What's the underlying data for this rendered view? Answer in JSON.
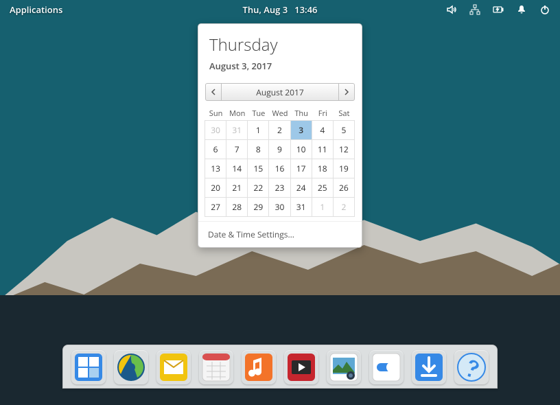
{
  "topbar": {
    "applications_label": "Applications",
    "date_text": "Thu, Aug  3",
    "time_text": "13:46"
  },
  "calendar": {
    "day_name": "Thursday",
    "full_date": "August  3, 2017",
    "month_label": "August 2017",
    "weekday_headers": [
      "Sun",
      "Mon",
      "Tue",
      "Wed",
      "Thu",
      "Fri",
      "Sat"
    ],
    "grid": [
      [
        {
          "n": "30",
          "dim": true
        },
        {
          "n": "31",
          "dim": true
        },
        {
          "n": "1"
        },
        {
          "n": "2"
        },
        {
          "n": "3",
          "sel": true
        },
        {
          "n": "4"
        },
        {
          "n": "5"
        }
      ],
      [
        {
          "n": "6"
        },
        {
          "n": "7"
        },
        {
          "n": "8"
        },
        {
          "n": "9"
        },
        {
          "n": "10"
        },
        {
          "n": "11"
        },
        {
          "n": "12"
        }
      ],
      [
        {
          "n": "13"
        },
        {
          "n": "14"
        },
        {
          "n": "15"
        },
        {
          "n": "16"
        },
        {
          "n": "17"
        },
        {
          "n": "18"
        },
        {
          "n": "19"
        }
      ],
      [
        {
          "n": "20"
        },
        {
          "n": "21"
        },
        {
          "n": "22"
        },
        {
          "n": "23"
        },
        {
          "n": "24"
        },
        {
          "n": "25"
        },
        {
          "n": "26"
        }
      ],
      [
        {
          "n": "27"
        },
        {
          "n": "28"
        },
        {
          "n": "29"
        },
        {
          "n": "30"
        },
        {
          "n": "31"
        },
        {
          "n": "1",
          "dim": true
        },
        {
          "n": "2",
          "dim": true
        }
      ]
    ],
    "settings_label": "Date & Time Settings..."
  },
  "dock": {
    "items": [
      {
        "name": "multitasking-view",
        "color": "#3689e6"
      },
      {
        "name": "web-browser",
        "color": "#2b7a2b"
      },
      {
        "name": "mail",
        "color": "#f1c40f"
      },
      {
        "name": "calendar-app",
        "color": "#eeeeee"
      },
      {
        "name": "music",
        "color": "#f37329"
      },
      {
        "name": "videos",
        "color": "#c6262e"
      },
      {
        "name": "photos",
        "color": "#485a6c"
      },
      {
        "name": "switchboard",
        "color": "#3689e6"
      },
      {
        "name": "appcenter",
        "color": "#3689e6"
      },
      {
        "name": "help",
        "color": "#d4e9f7"
      }
    ]
  }
}
